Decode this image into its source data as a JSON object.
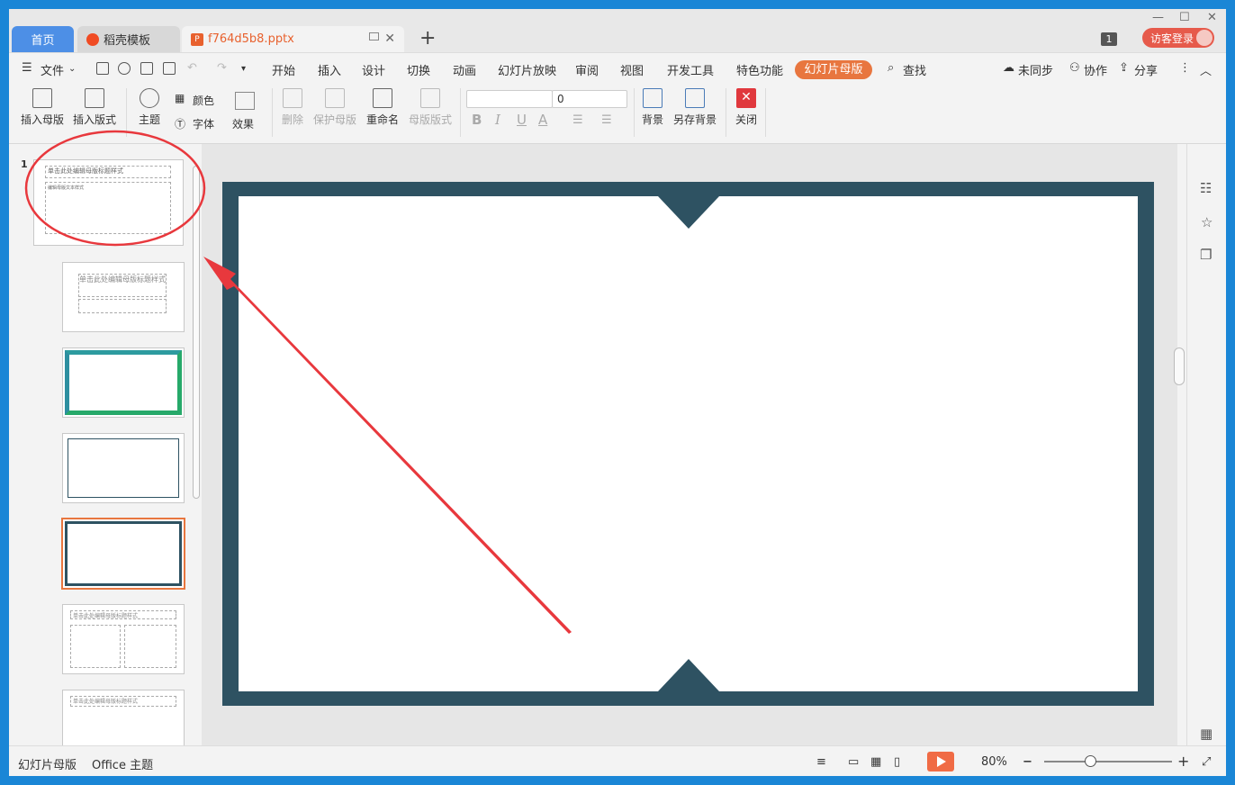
{
  "tabs": {
    "home": "首页",
    "daoke": "稻壳模板",
    "file": "f764d5b8.pptx",
    "add": "+"
  },
  "window": {
    "badge": "1",
    "visitor_login": "访客登录"
  },
  "menu": {
    "file": "文件",
    "items": [
      "开始",
      "插入",
      "设计",
      "切换",
      "动画",
      "幻灯片放映",
      "审阅",
      "视图",
      "开发工具",
      "特色功能"
    ],
    "active": "幻灯片母版",
    "search": "查找",
    "sync": "未同步",
    "collab": "协作",
    "share": "分享"
  },
  "ribbon": {
    "insert_master": "插入母版",
    "insert_layout": "插入版式",
    "theme": "主题",
    "colors": "颜色",
    "fonts": "字体",
    "effects": "效果",
    "delete": "删除",
    "protect_master": "保护母版",
    "rename": "重命名",
    "master_layout": "母版版式",
    "font_size": "0",
    "bold": "B",
    "italic": "I",
    "underline": "U",
    "font_color": "A",
    "background": "背景",
    "save_background": "另存背景",
    "close": "关闭"
  },
  "thumbnails": {
    "first_number": "1",
    "master_title": "单击此处编辑母版标题样式",
    "master_text": "编辑母版文本样式",
    "title_layout_title": "单击此处编辑母版标题样式",
    "section_title": "单击此处编辑母版标题样式"
  },
  "status": {
    "mode": "幻灯片母版",
    "theme": "Office 主题",
    "zoom": "80%"
  },
  "colors": {
    "accent": "#e8763f",
    "slide_border": "#2e5262",
    "annotation": "#e8383d",
    "home_tab": "#4d8fe6"
  }
}
